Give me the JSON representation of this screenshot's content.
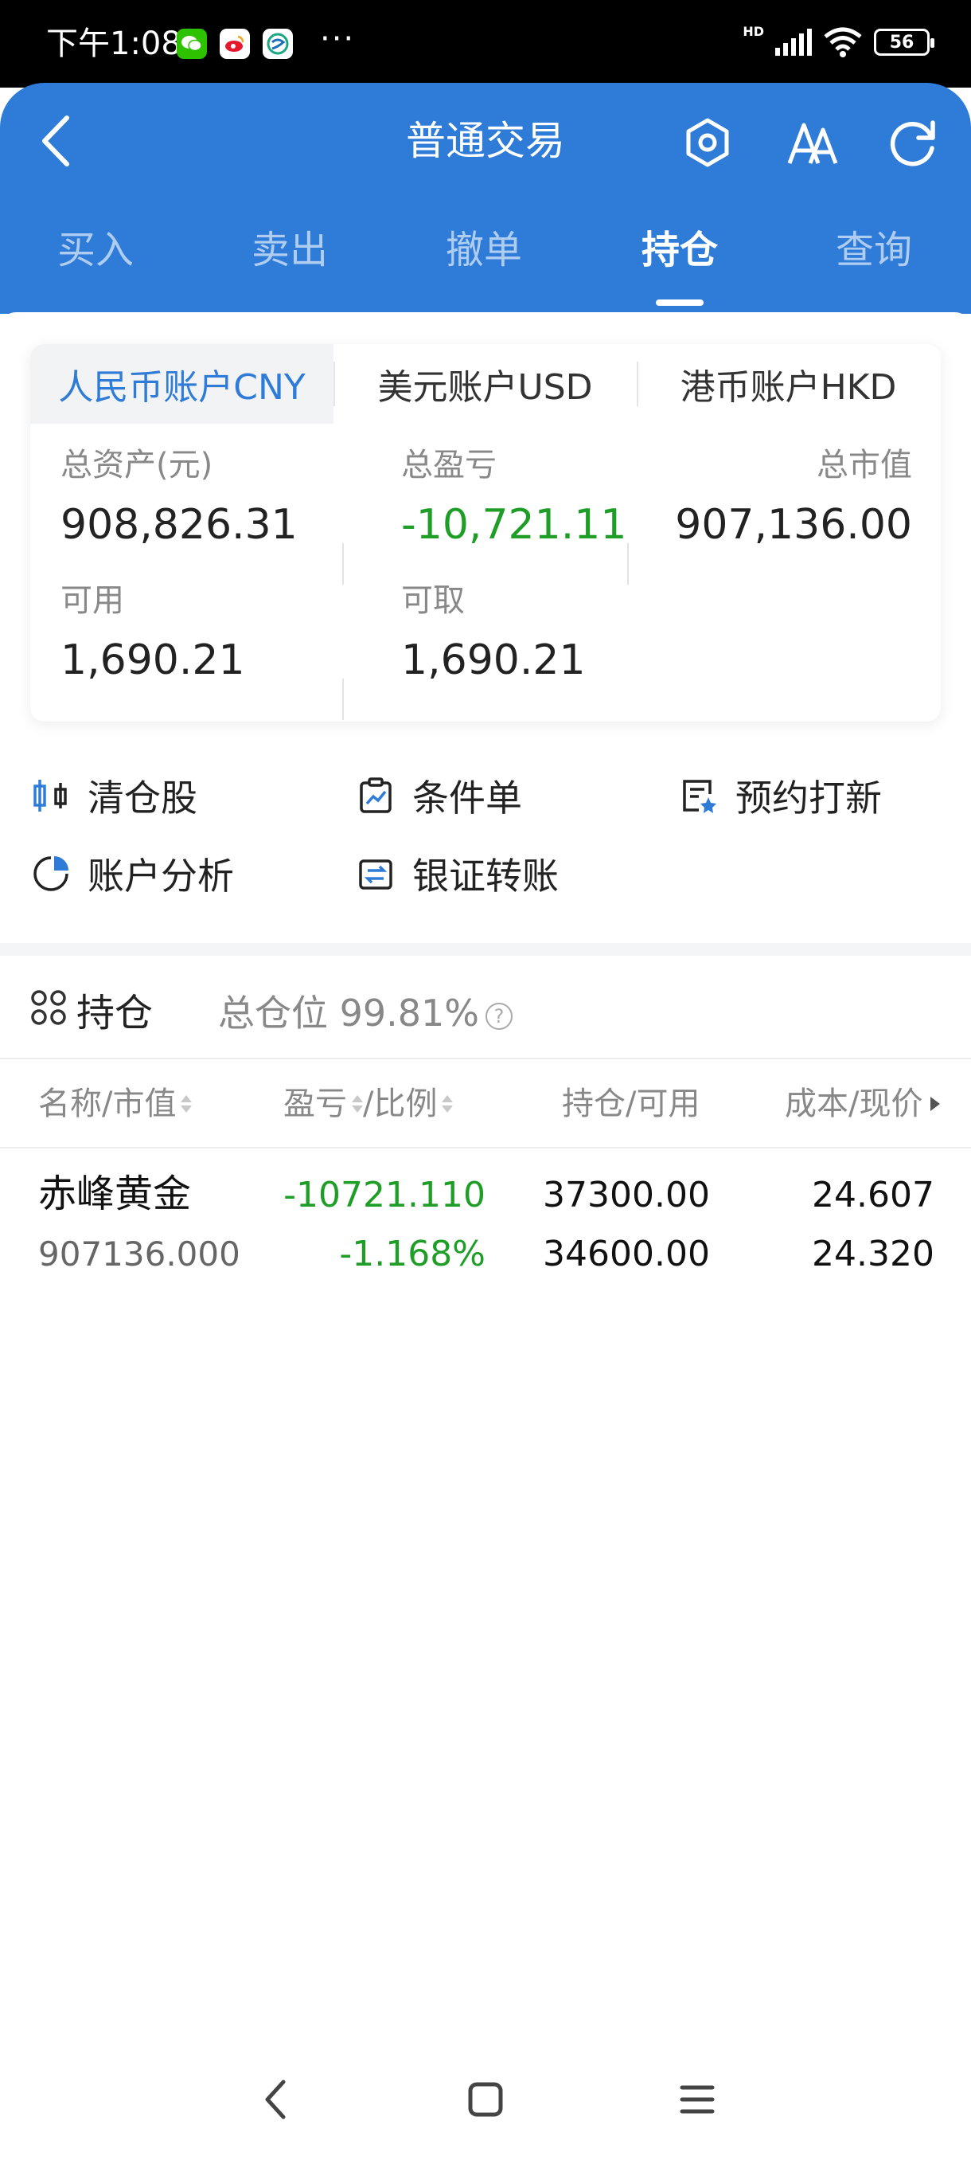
{
  "status_bar": {
    "time": "下午1:08",
    "apps": [
      "wechat-icon",
      "sina-icon",
      "china-mobile-icon"
    ],
    "more": "···",
    "network_label": "HD",
    "battery": "56"
  },
  "header": {
    "title": "普通交易",
    "icons": [
      "back-icon",
      "settings-icon",
      "font-size-icon",
      "refresh-icon"
    ]
  },
  "tabs": [
    {
      "label": "买入",
      "active": false
    },
    {
      "label": "卖出",
      "active": false
    },
    {
      "label": "撤单",
      "active": false
    },
    {
      "label": "持仓",
      "active": true
    },
    {
      "label": "查询",
      "active": false
    }
  ],
  "account_tabs": [
    "人民币账户CNY",
    "美元账户USD",
    "港币账户HKD"
  ],
  "account": {
    "total_assets_label": "总资产(元)",
    "total_assets": "908,826.31",
    "total_pnl_label": "总盈亏",
    "total_pnl": "-10,721.11",
    "market_value_label": "总市值",
    "market_value": "907,136.00",
    "available_label": "可用",
    "available": "1,690.21",
    "withdrawable_label": "可取",
    "withdrawable": "1,690.21"
  },
  "quick_actions": [
    {
      "label": "清仓股",
      "icon": "clear-position-icon"
    },
    {
      "label": "条件单",
      "icon": "conditional-order-icon"
    },
    {
      "label": "预约打新",
      "icon": "ipo-reservation-icon"
    },
    {
      "label": "账户分析",
      "icon": "pie-chart-icon"
    },
    {
      "label": "银证转账",
      "icon": "transfer-icon"
    }
  ],
  "holdings": {
    "title": "持仓",
    "summary": "总仓位 99.81%",
    "columns": {
      "name_mv": "名称/市值",
      "pnl": "盈亏",
      "ratio": "/比例",
      "position": "持仓/可用",
      "cost_price": "成本/现价"
    },
    "rows": [
      {
        "name": "赤峰黄金",
        "market_value": "907136.000",
        "pnl": "-10721.110",
        "pnl_ratio": "-1.168%",
        "position": "37300.00",
        "available": "34600.00",
        "cost": "24.607",
        "price": "24.320"
      }
    ]
  },
  "colors": {
    "brand_blue": "#2f7bd8",
    "loss_green": "#1f9e27"
  }
}
